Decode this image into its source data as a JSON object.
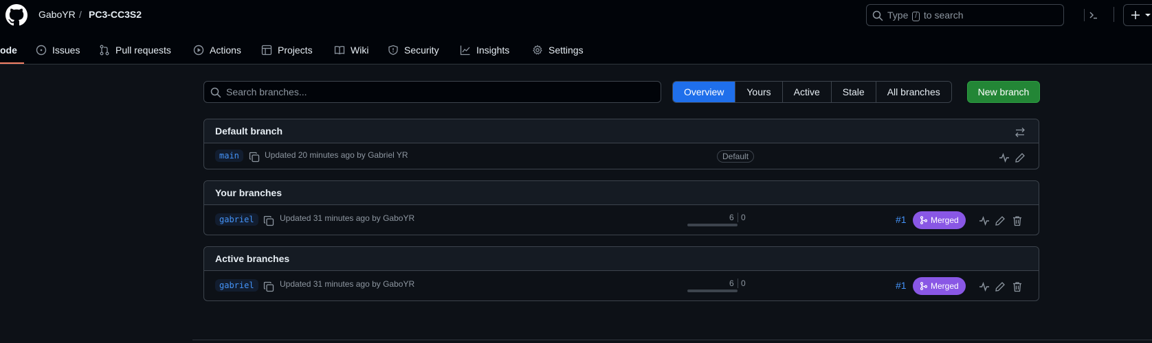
{
  "header": {
    "owner": "GaboYR",
    "separator": "/",
    "repo": "PC3-CC3S2",
    "search": {
      "prefix": "Type",
      "key": "/",
      "suffix": "to search"
    }
  },
  "nav": {
    "tabs": [
      {
        "label": "Code",
        "display": "ode",
        "icon": "code-icon",
        "active": true
      },
      {
        "label": "Issues",
        "icon": "issue-icon"
      },
      {
        "label": "Pull requests",
        "icon": "pull-request-icon"
      },
      {
        "label": "Actions",
        "icon": "play-icon"
      },
      {
        "label": "Projects",
        "icon": "table-icon"
      },
      {
        "label": "Wiki",
        "icon": "book-icon"
      },
      {
        "label": "Security",
        "icon": "shield-icon"
      },
      {
        "label": "Insights",
        "icon": "graph-icon"
      },
      {
        "label": "Settings",
        "icon": "gear-icon"
      }
    ]
  },
  "branches_page": {
    "search_placeholder": "Search branches...",
    "filters": [
      "Overview",
      "Yours",
      "Active",
      "Stale",
      "All branches"
    ],
    "active_filter": "Overview",
    "new_branch_label": "New branch"
  },
  "sections": {
    "default": {
      "title": "Default branch",
      "branch": "main",
      "updated": "Updated 20 minutes ago by Gabriel YR",
      "badge": "Default"
    },
    "yours": {
      "title": "Your branches",
      "branch": "gabriel",
      "updated": "Updated 31 minutes ago by GaboYR",
      "behind": "6",
      "ahead": "0",
      "pr": "#1",
      "pr_state": "Merged"
    },
    "active": {
      "title": "Active branches",
      "branch": "gabriel",
      "updated": "Updated 31 minutes ago by GaboYR",
      "behind": "6",
      "ahead": "0",
      "pr": "#1",
      "pr_state": "Merged"
    }
  },
  "colors": {
    "accent": "#1f6feb",
    "primary_button": "#238636",
    "merged": "#8957e5",
    "link": "#4493f8",
    "tab_underline": "#f78166"
  }
}
